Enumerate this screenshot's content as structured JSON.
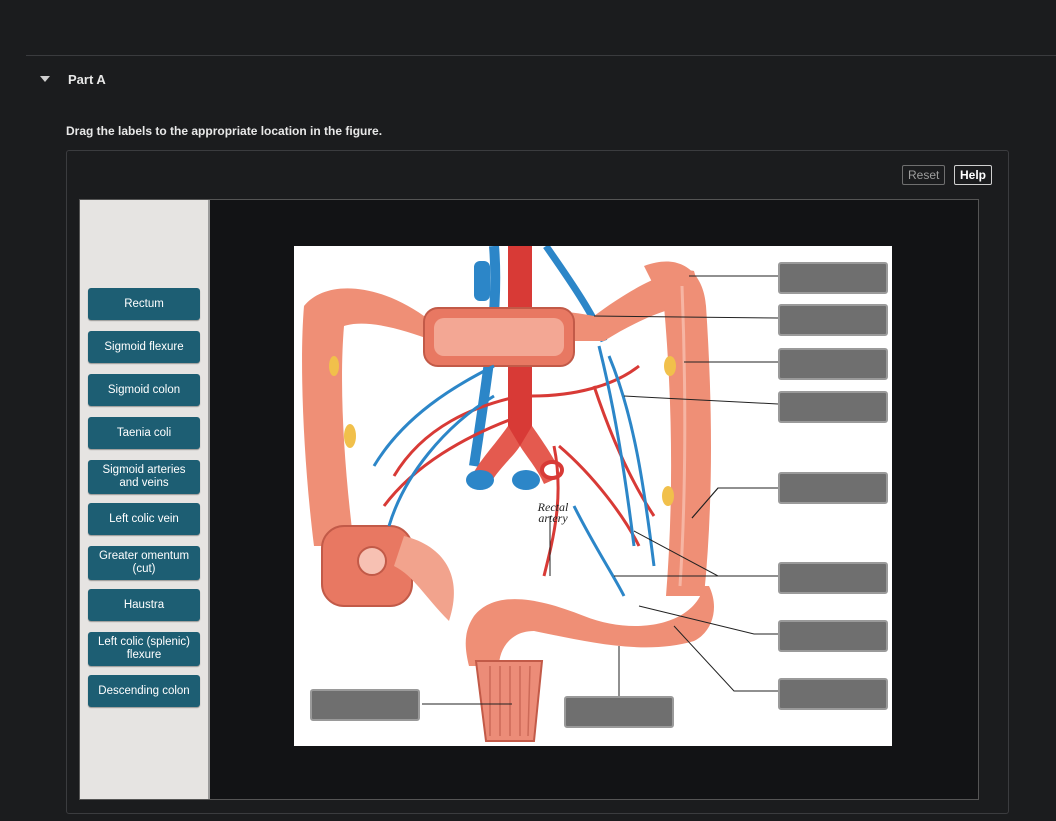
{
  "part": {
    "title": "Part A",
    "instruction": "Drag the labels to the appropriate location in the figure."
  },
  "toolbar": {
    "reset_label": "Reset",
    "help_label": "Help"
  },
  "labels": [
    {
      "text": "Rectum"
    },
    {
      "text": "Sigmoid flexure"
    },
    {
      "text": "Sigmoid colon"
    },
    {
      "text": "Taenia coli"
    },
    {
      "text": "Sigmoid arteries and veins"
    },
    {
      "text": "Left colic vein"
    },
    {
      "text": "Greater omentum (cut)"
    },
    {
      "text": "Haustra"
    },
    {
      "text": "Left colic (splenic) flexure"
    },
    {
      "text": "Descending colon"
    }
  ],
  "figure": {
    "annotation": "Rectal artery",
    "annotation_lines": [
      "Rectal",
      "artery"
    ]
  },
  "colors": {
    "label_bg": "#1d5e73",
    "drop_zone": "#6f6f6f",
    "colon": "#ef8f76",
    "artery": "#d83a36",
    "vein": "#2c86c8"
  }
}
